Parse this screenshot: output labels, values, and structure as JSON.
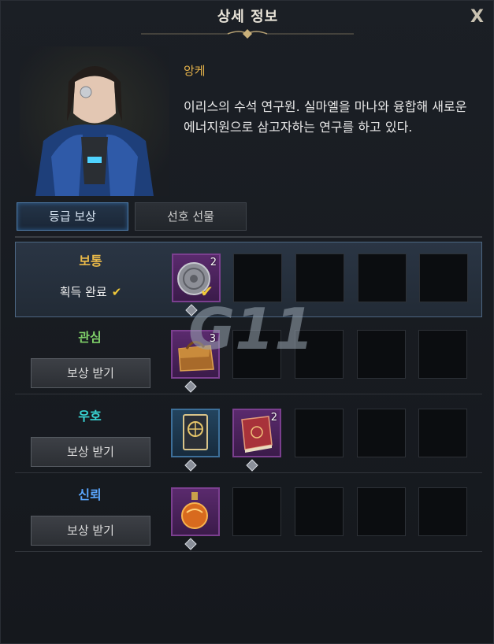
{
  "window": {
    "title": "상세 정보",
    "close_label": "X"
  },
  "npc": {
    "name": "앙케",
    "description": "이리스의 수석 연구원. 실마엘을 마나와 융합해 새로운 에너지원으로 삼고자하는 연구를 하고 있다."
  },
  "tabs": [
    {
      "label": "등급 보상",
      "active": true
    },
    {
      "label": "선호 선물",
      "active": false
    }
  ],
  "tiers": [
    {
      "name": "보통",
      "color": "#e9b949",
      "status": "획득 완료",
      "claimed": true,
      "rewards": [
        {
          "icon": "silver-coin-icon",
          "count": "2",
          "obtained": true
        }
      ]
    },
    {
      "name": "관심",
      "color": "#7fd069",
      "button": "보상 받기",
      "rewards": [
        {
          "icon": "leather-satchel-icon",
          "count": "3"
        }
      ]
    },
    {
      "name": "우호",
      "color": "#39d6d6",
      "button": "보상 받기",
      "rewards": [
        {
          "icon": "card-pack-icon",
          "count": ""
        },
        {
          "icon": "red-tome-icon",
          "count": "2"
        }
      ]
    },
    {
      "name": "신뢰",
      "color": "#5aa7ff",
      "button": "보상 받기",
      "rewards": [
        {
          "icon": "potion-flask-icon",
          "count": ""
        }
      ]
    }
  ],
  "watermark": "G11"
}
